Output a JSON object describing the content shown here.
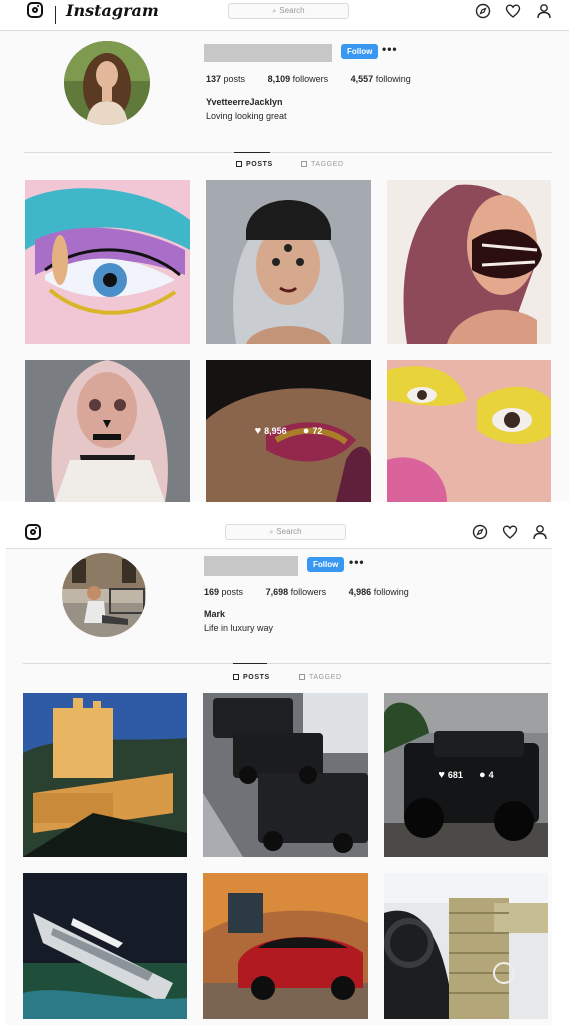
{
  "screens": [
    {
      "brand": {
        "wordmark": "Instagram"
      },
      "search": {
        "placeholder": "Search"
      },
      "profile": {
        "follow_label": "Follow",
        "more_label": "•••",
        "stats": {
          "posts": "137",
          "posts_label": "posts",
          "followers": "8,109",
          "followers_label": "followers",
          "following": "4,557",
          "following_label": "following"
        },
        "fullname": "YvetteerreJacklyn",
        "bio": "Loving looking great"
      },
      "tabs": {
        "posts": "POSTS",
        "tagged": "TAGGED"
      },
      "hover_post": {
        "likes": "8,956",
        "comments": "72"
      }
    },
    {
      "search": {
        "placeholder": "Search"
      },
      "profile": {
        "follow_label": "Follow",
        "more_label": "•••",
        "stats": {
          "posts": "169",
          "posts_label": "posts",
          "followers": "7,698",
          "followers_label": "followers",
          "following": "4,986",
          "following_label": "following"
        },
        "fullname": "Mark",
        "bio": "Life in luxury way"
      },
      "tabs": {
        "posts": "POSTS",
        "tagged": "TAGGED"
      },
      "hover_post": {
        "likes": "681",
        "comments": "4"
      }
    }
  ],
  "icons": [
    "instagram-logo-icon",
    "search-icon",
    "compass-icon",
    "heart-icon",
    "person-icon",
    "grid-icon",
    "tag-icon",
    "comment-icon"
  ],
  "colors": {
    "follow_blue": "#3897f0",
    "border": "#dbdbdb",
    "background": "#fafafa"
  }
}
